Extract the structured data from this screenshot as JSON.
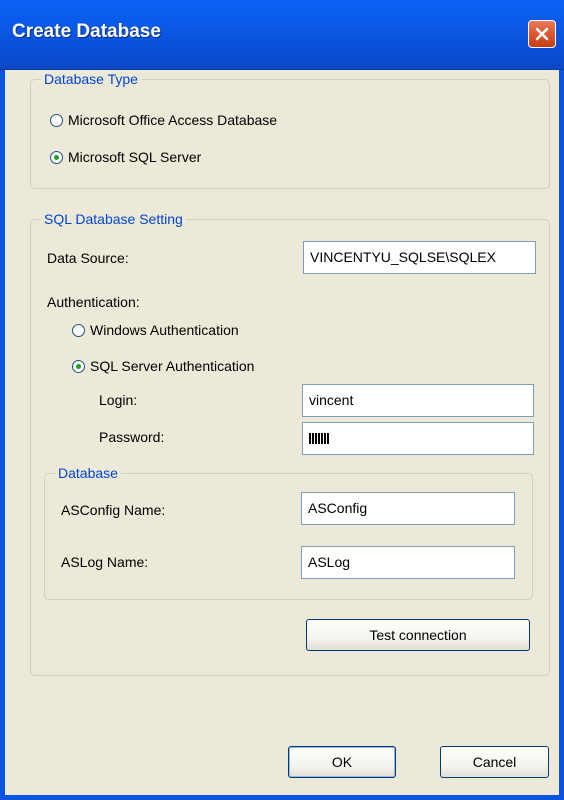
{
  "window": {
    "title": "Create Database"
  },
  "database_type": {
    "legend": "Database Type",
    "options": [
      {
        "label": "Microsoft Office Access Database",
        "selected": false
      },
      {
        "label": "Microsoft SQL Server",
        "selected": true
      }
    ]
  },
  "sql_setting": {
    "legend": "SQL Database Setting",
    "data_source_label": "Data Source:",
    "data_source_value": "VINCENTYU_SQLSE\\SQLEX",
    "authentication_label": "Authentication:",
    "windows_auth_label": "Windows Authentication",
    "sql_auth_label": "SQL Server Authentication",
    "sql_auth_selected": true,
    "login_label": "Login:",
    "login_value": "vincent",
    "password_label": "Password:",
    "password_mask_length": 7
  },
  "database": {
    "legend": "Database",
    "asconfig_label": "ASConfig Name:",
    "asconfig_value": "ASConfig",
    "aslog_label": "ASLog Name:",
    "aslog_value": "ASLog"
  },
  "buttons": {
    "test_connection": "Test connection",
    "ok": "OK",
    "cancel": "Cancel"
  },
  "icons": {
    "close": "close-icon"
  },
  "colors": {
    "title_bar": "#0a5ae8",
    "group_legend": "#0046d5",
    "close_button": "#d9532b"
  }
}
